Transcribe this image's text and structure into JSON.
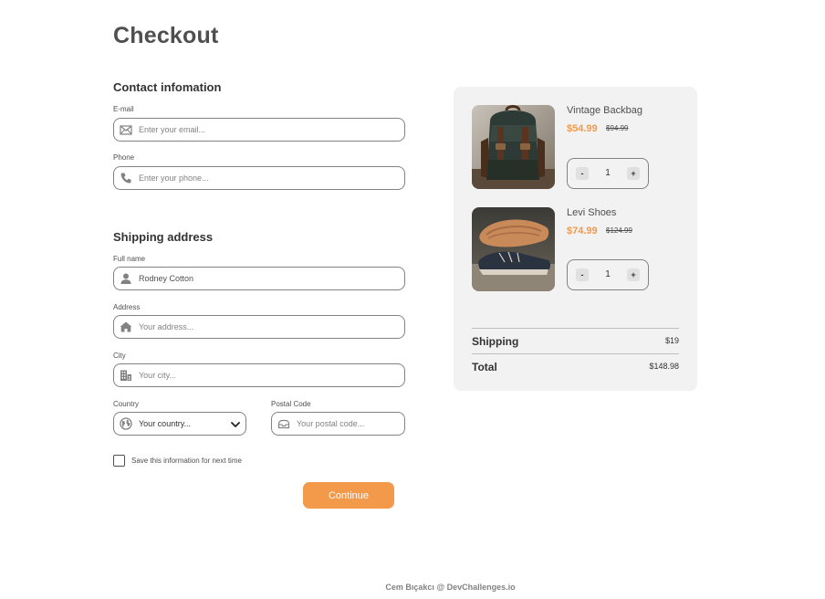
{
  "page_title": "Checkout",
  "contact": {
    "title": "Contact infomation",
    "email_label": "E-mail",
    "email_placeholder": "Enter your email...",
    "phone_label": "Phone",
    "phone_placeholder": "Enter your phone..."
  },
  "shipping": {
    "title": "Shipping address",
    "fullname_label": "Full name",
    "fullname_value": "Rodney Cotton",
    "address_label": "Address",
    "address_placeholder": "Your address...",
    "city_label": "City",
    "city_placeholder": "Your city...",
    "country_label": "Country",
    "country_value": "Your country...",
    "postal_label": "Postal Code",
    "postal_placeholder": "Your postal code..."
  },
  "save_info_label": "Save this information for next time",
  "continue_label": "Continue",
  "footer": "Cem Bıçakcı @ DevChallenges.io",
  "cart": {
    "items": [
      {
        "name": "Vintage Backbag",
        "price": "$54.99",
        "old_price": "$94.99",
        "quantity": "1",
        "image": "backpack"
      },
      {
        "name": "Levi Shoes",
        "price": "$74.99",
        "old_price": "$124.99",
        "quantity": "1",
        "image": "shoes"
      }
    ],
    "minus_label": "-",
    "plus_label": "+",
    "shipping_label": "Shipping",
    "shipping_value": "$19",
    "total_label": "Total",
    "total_value": "$148.98"
  },
  "colors": {
    "accent": "#f2994a",
    "panel": "#f2f2f2",
    "text": "#4f4f4f",
    "border": "#828282"
  }
}
